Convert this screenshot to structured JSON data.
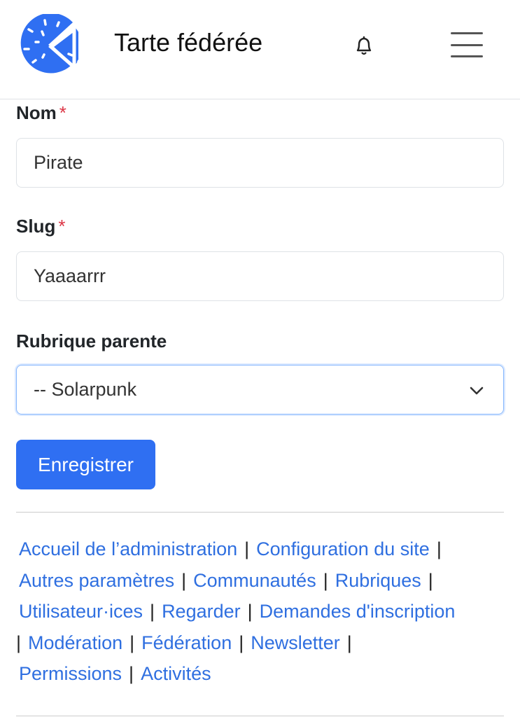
{
  "header": {
    "site_title": "Tarte fédérée",
    "logo_icon": "pie-slice-logo",
    "notifications_icon": "bell-icon",
    "menu_icon": "hamburger-menu-icon"
  },
  "form": {
    "name": {
      "label": "Nom",
      "required_mark": "*",
      "value": "Pirate"
    },
    "slug": {
      "label": "Slug",
      "required_mark": "*",
      "value": "Yaaaarrr"
    },
    "parent": {
      "label": "Rubrique parente",
      "selected": "-- Solarpunk"
    },
    "submit_label": "Enregistrer"
  },
  "footer": {
    "separator": "|",
    "links": [
      "Accueil de l’administration",
      "Configuration du site",
      "Autres paramètres",
      "Communautés",
      "Rubriques",
      "Utilisateur·ices",
      "Regarder",
      "Demandes d'inscription",
      "Modération",
      "Fédération",
      "Newsletter",
      "Permissions",
      "Activités"
    ]
  },
  "colors": {
    "accent": "#2f6ff2",
    "link": "#2f6fe0",
    "required": "#dc3545"
  }
}
